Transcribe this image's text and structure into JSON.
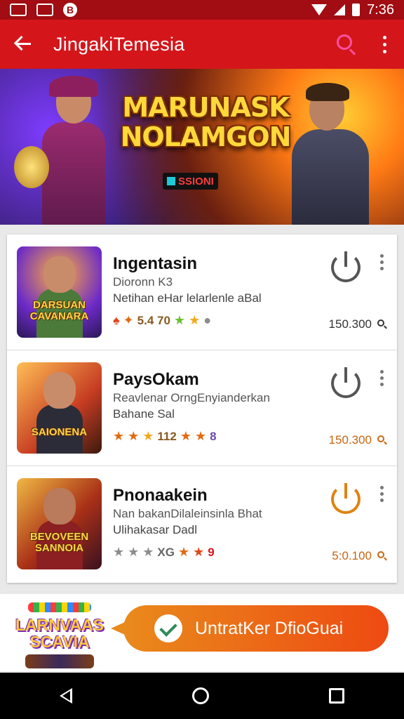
{
  "status_bar": {
    "time": "7:36",
    "icons": [
      "notification-icon",
      "image-icon",
      "app-badge-icon",
      "wifi-icon",
      "signal-icon",
      "battery-icon"
    ]
  },
  "app_bar": {
    "title": "JingakiTemesia",
    "accent_color": "#d4161b",
    "search_color": "#ff4fa0"
  },
  "banner": {
    "title_line1": "MARUNASK",
    "title_line2": "NOLAMGON",
    "badge": "SSIONI"
  },
  "apps": [
    {
      "name": "Ingentasin",
      "developer": "Dioronn K3",
      "description": "Netihan eHar lelarlenle aBal",
      "rating_text": "5.4 70",
      "count": "150.300",
      "thumb_label": "DARSUAN CAVANARA",
      "count_color": "#333333"
    },
    {
      "name": "PaysOkam",
      "developer": "Reavlenar OrngEnyianderkan",
      "description": "Bahane Sal",
      "rating_text": "112",
      "rating_text2": "8",
      "count": "150.300",
      "thumb_label": "SAIONENA",
      "count_color": "#c86612"
    },
    {
      "name": "Pnonaakein",
      "developer": "Nan bakanDilaleinsinla Bhat",
      "description": "Ulihakasar Dadl",
      "rating_text": "XG",
      "rating_text2": "9",
      "count": "5:0.100",
      "thumb_label": "BEVOVEEN SANNOIA",
      "count_color": "#c86612"
    }
  ],
  "promo": {
    "logo_text_line1": "LARNVAAS",
    "logo_text_line2": "SCAVIA",
    "button_label": "UntratKer DfioGuai"
  }
}
